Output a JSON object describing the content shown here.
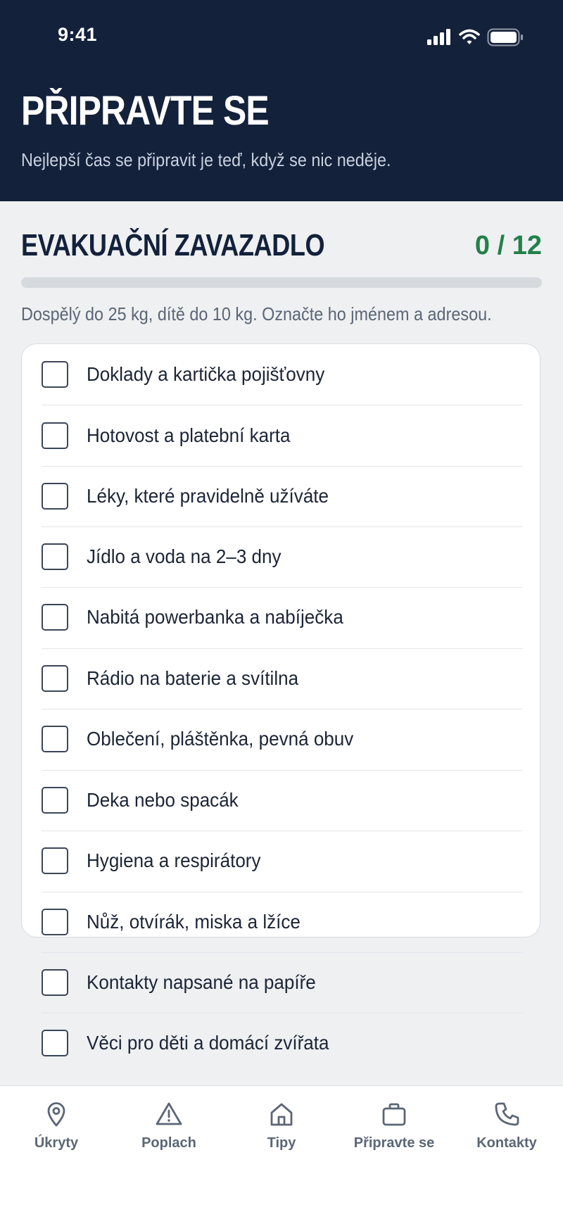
{
  "status_bar": {
    "time": "9:41"
  },
  "header": {
    "title": "PŘIPRAVTE SE",
    "subtitle": "Nejlepší čas se připravit je teď, když se nic neděje."
  },
  "section": {
    "title": "EVAKUAČNÍ ZAVAZADLO",
    "counter": "0 / 12",
    "progress": 0,
    "description": "Dospělý do 25 kg, dítě do 10 kg. Označte ho jménem a adresou."
  },
  "checklist": [
    {
      "label": "Doklady a kartička pojišťovny",
      "checked": false
    },
    {
      "label": "Hotovost a platební karta",
      "checked": false
    },
    {
      "label": "Léky, které pravidelně užíváte",
      "checked": false
    },
    {
      "label": "Jídlo a voda na 2–3 dny",
      "checked": false
    },
    {
      "label": "Nabitá powerbanka a nabíječka",
      "checked": false
    },
    {
      "label": "Rádio na baterie a svítilna",
      "checked": false
    },
    {
      "label": "Oblečení, pláštěnka, pevná obuv",
      "checked": false
    },
    {
      "label": "Deka nebo spacák",
      "checked": false
    },
    {
      "label": "Hygiena a respirátory",
      "checked": false
    },
    {
      "label": "Nůž, otvírák, miska a lžíce",
      "checked": false
    },
    {
      "label": "Kontakty napsané na papíře",
      "checked": false
    },
    {
      "label": "Věci pro děti a domácí zvířata",
      "checked": false
    }
  ],
  "nav": {
    "items": [
      {
        "label": "Úkryty",
        "icon": "map-pin-icon"
      },
      {
        "label": "Poplach",
        "icon": "warning-triangle-icon"
      },
      {
        "label": "Tipy",
        "icon": "home-icon"
      },
      {
        "label": "Připravte se",
        "icon": "briefcase-icon"
      },
      {
        "label": "Kontakty",
        "icon": "phone-icon"
      }
    ]
  },
  "colors": {
    "header_bg": "#13213b",
    "accent_green": "#23804a",
    "page_bg": "#eef0f2"
  }
}
